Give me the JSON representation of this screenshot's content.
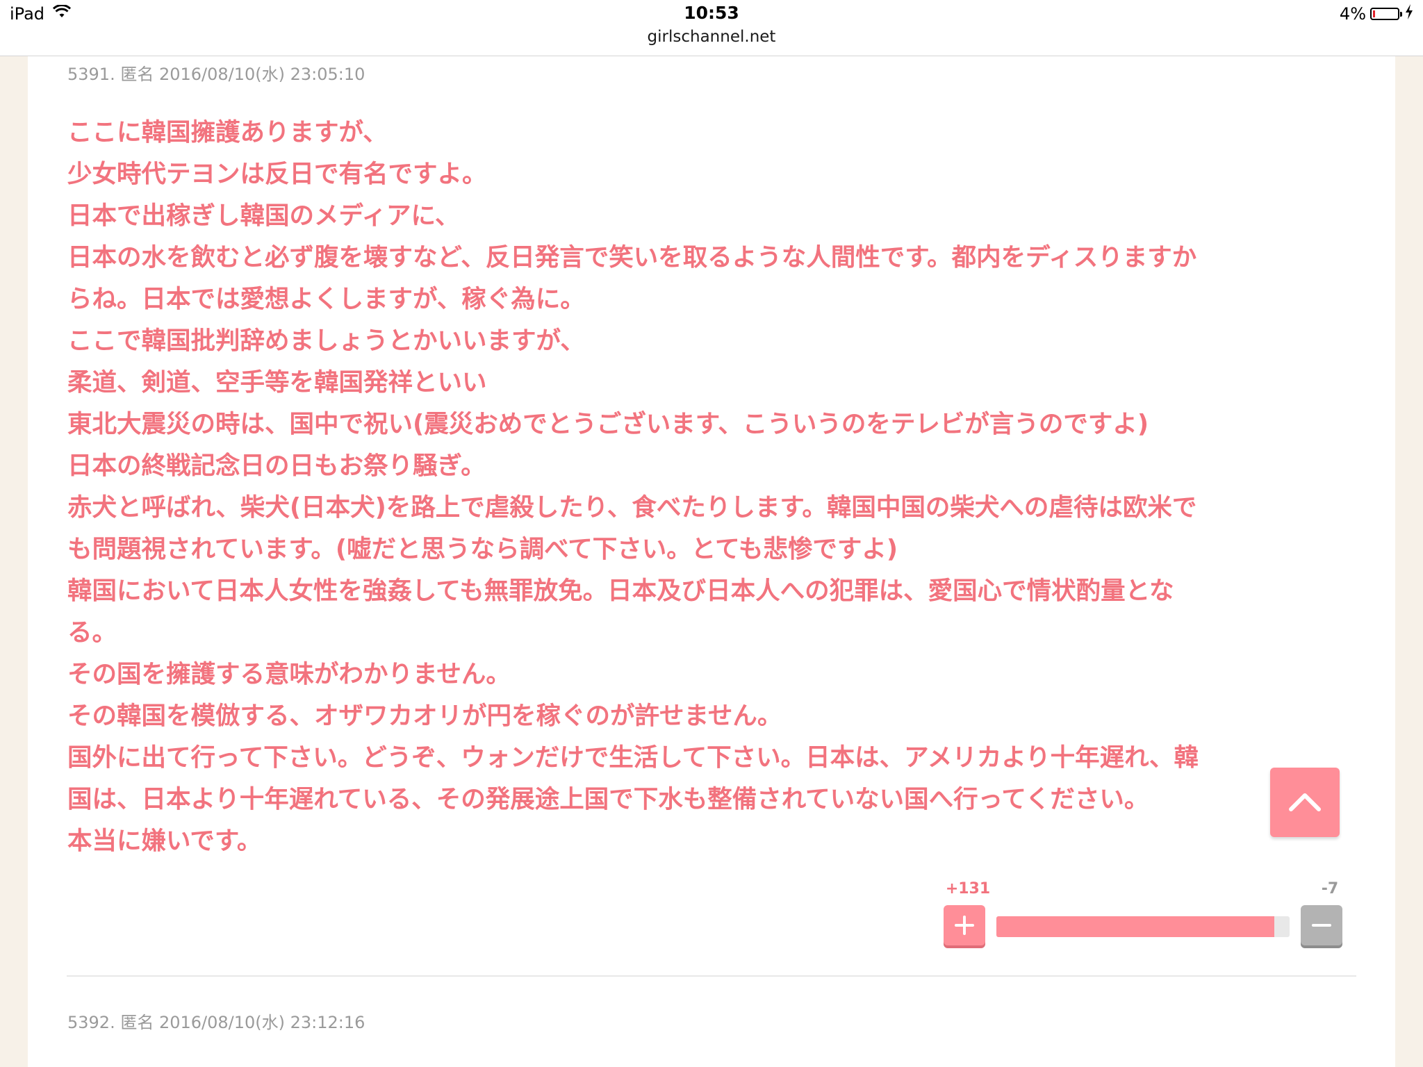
{
  "status_bar": {
    "device": "iPad",
    "time": "10:53",
    "url": "girlschannel.net",
    "battery": "4%"
  },
  "comments": [
    {
      "meta": "5391. 匿名 2016/08/10(水) 23:05:10",
      "lines": [
        "ここに韓国擁護ありますが、",
        "少女時代テヨンは反日で有名ですよ。",
        "日本で出稼ぎし韓国のメディアに、",
        "日本の水を飲むと必ず腹を壊すなど、反日発言で笑いを取るような人間性です。都内をディスりますか",
        "らね。日本では愛想よくしますが、稼ぐ為に。",
        "ここで韓国批判辞めましょうとかいいますが、",
        "柔道、剣道、空手等を韓国発祥といい",
        "東北大震災の時は、国中で祝い(震災おめでとうございます、こういうのをテレビが言うのですよ)",
        "日本の終戦記念日の日もお祭り騒ぎ。",
        "赤犬と呼ばれ、柴犬(日本犬)を路上で虐殺したり、食べたりします。韓国中国の柴犬への虐待は欧米で",
        "も問題視されています。(嘘だと思うなら調べて下さい。とても悲惨ですよ)",
        "韓国において日本人女性を強姦しても無罪放免。日本及び日本人への犯罪は、愛国心で情状酌量とな",
        "る。",
        "その国を擁護する意味がわかりません。",
        "その韓国を模倣する、オザワカオリが円を稼ぐのが許せません。",
        "国外に出て行って下さい。どうぞ、ウォンだけで生活して下さい。日本は、アメリカより十年遅れ、韓",
        "国は、日本より十年遅れている、その発展途上国で下水も整備されていない国へ行ってください。",
        "本当に嫌いです。"
      ],
      "votes": {
        "plus": "+131",
        "minus": "-7",
        "plus_fraction": 0.949
      }
    },
    {
      "meta": "5392. 匿名 2016/08/10(水) 23:12:16"
    }
  ],
  "icons": {
    "wifi": "wifi-icon",
    "battery": "battery-icon",
    "charging": "charging-icon",
    "scroll_top": "chevron-up-icon",
    "plus": "plus-icon",
    "minus": "minus-icon"
  },
  "colors": {
    "comment_text": "#f2737e",
    "accent": "#ff8e98",
    "minus_button": "#b3b3b3",
    "page_background": "#f7f1e8"
  }
}
